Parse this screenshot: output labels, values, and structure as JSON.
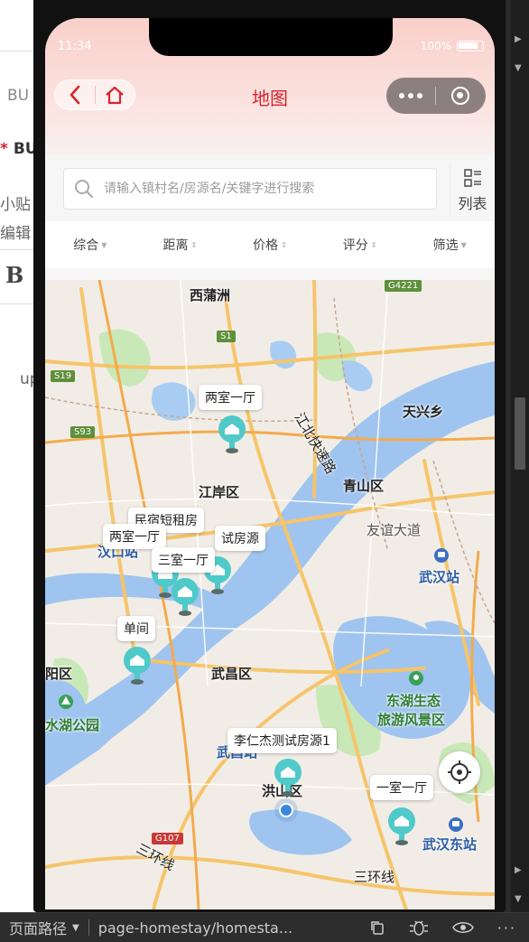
{
  "ide": {
    "left_snippets": [
      "BU",
      "* BU",
      "小贴",
      "编辑",
      "B",
      "up"
    ]
  },
  "status_bar": {
    "time": "11:34",
    "battery": "100%"
  },
  "nav": {
    "title": "地图"
  },
  "search": {
    "placeholder": "请输入镇村名/房源名/关键字进行搜索",
    "list_label": "列表"
  },
  "filters": [
    "综合",
    "距离",
    "价格",
    "评分",
    "筛选"
  ],
  "map": {
    "places": {
      "xipuzhou": "西蒲洲",
      "tianxingxiang": "天兴乡",
      "jianganqu": "江岸区",
      "qingshanqu": "青山区",
      "youyidadao": "友谊大道",
      "hankouzhan": "汉口站",
      "wuhanzhan": "武汉站",
      "wuchangqu": "武昌区",
      "hanyangqu": "阳区",
      "donghu": "东湖生态",
      "donghu2": "旅游风景区",
      "moshuihu": "水湖公园",
      "wuchangzhan": "武昌站",
      "hongshanqu": "洪山区",
      "wuhandongzhan": "武汉东站",
      "sanhuanxian1": "三环线",
      "sanhuanxian2": "三环线",
      "jiangbei": "江北快速路",
      "cun": "区"
    },
    "road_tags": [
      "S1",
      "S19",
      "S93",
      "G4221",
      "G107"
    ],
    "listings": [
      {
        "label": "两室一厅"
      },
      {
        "label": "民宿短租房"
      },
      {
        "label": "两室一厅"
      },
      {
        "label": "试房源"
      },
      {
        "label": "三室一厅"
      },
      {
        "label": "单间"
      },
      {
        "label": "李仁杰测试房源1"
      },
      {
        "label": "一室一厅"
      }
    ]
  },
  "bottom_bar": {
    "path_label": "页面路径",
    "path_value": "page-homestay/homesta..."
  },
  "colors": {
    "brand": "#d9232f",
    "pin": "#4fc9c9",
    "water": "#9fc4ef",
    "road": "#f6c46a"
  }
}
